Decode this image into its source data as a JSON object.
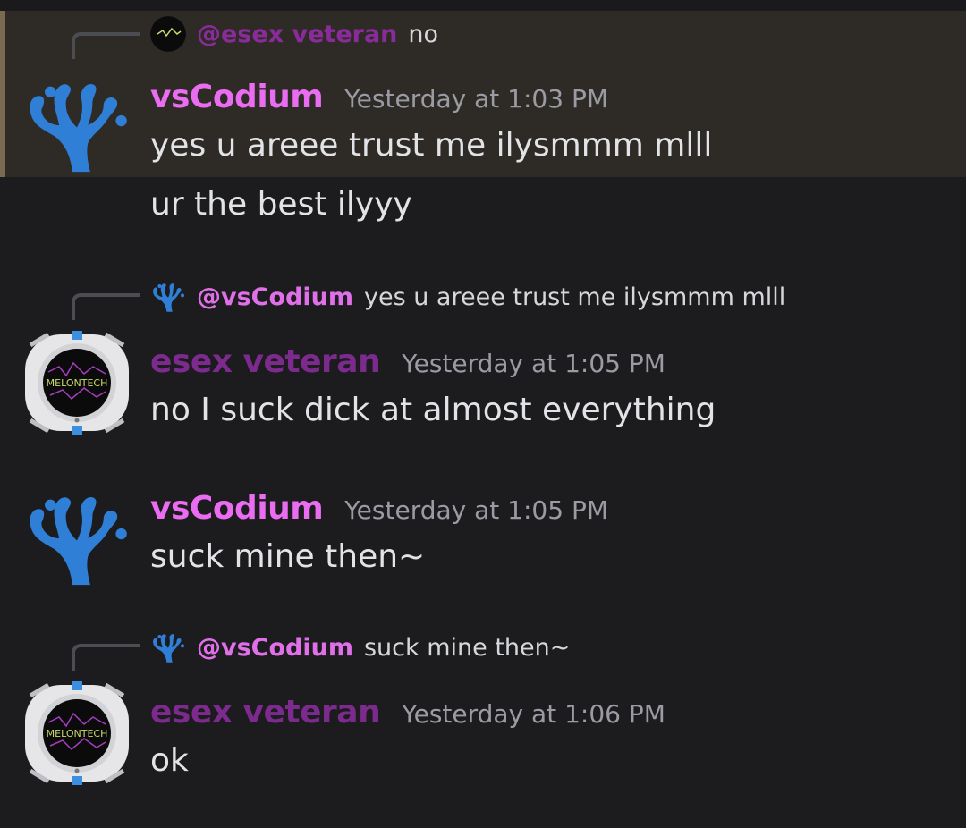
{
  "colors": {
    "background": "#1c1c1e",
    "highlight": "#2e2b27",
    "vscodium_name": "#ea6cf0",
    "esex_name": "#7c2a8e",
    "timestamp": "#9a9ba3",
    "vscodium_logo": "#2f7fd6"
  },
  "messages": [
    {
      "reply": {
        "mention": "@esex veteran",
        "text": "no",
        "avatar_icon": "melontech-avatar-icon"
      },
      "author": "vsCodium",
      "timestamp": "Yesterday at 1:03 PM",
      "lines": [
        "yes u areee trust me ilysmmm mlll",
        "ur the best ilyyy"
      ],
      "avatar_icon": "vscodium-coral-icon"
    },
    {
      "reply": {
        "mention": "@vsCodium",
        "text": "yes u areee trust me ilysmmm mlll",
        "avatar_icon": "vscodium-coral-icon"
      },
      "author": "esex veteran",
      "timestamp": "Yesterday at 1:05 PM",
      "lines": [
        "no I suck dick at almost everything"
      ],
      "avatar_icon": "portal-melontech-avatar-icon",
      "avatar_text": "MELONTECH"
    },
    {
      "author": "vsCodium",
      "timestamp": "Yesterday at 1:05 PM",
      "lines": [
        "suck mine then~"
      ],
      "avatar_icon": "vscodium-coral-icon"
    },
    {
      "reply": {
        "mention": "@vsCodium",
        "text": "suck mine then~",
        "avatar_icon": "vscodium-coral-icon"
      },
      "author": "esex veteran",
      "timestamp": "Yesterday at 1:06 PM",
      "lines": [
        "ok"
      ],
      "avatar_icon": "portal-melontech-avatar-icon",
      "avatar_text": "MELONTECH"
    }
  ]
}
